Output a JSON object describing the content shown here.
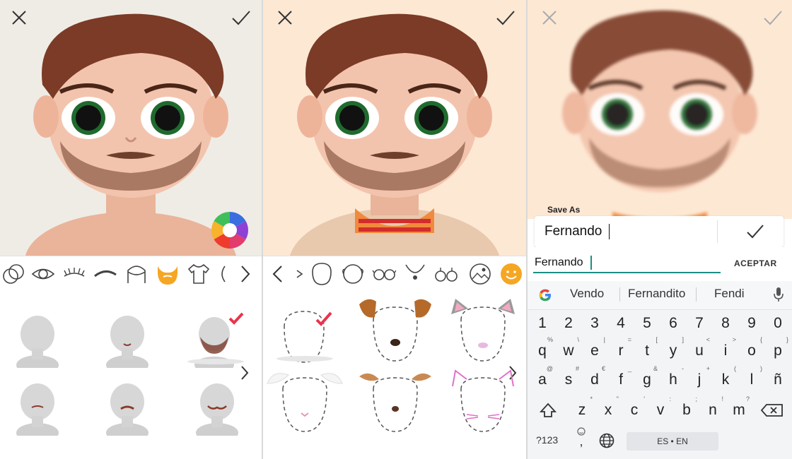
{
  "panels": {
    "dialog": {
      "label": "Save As",
      "value": "Fernando",
      "text_input": "Fernando",
      "accept_label": "ACEPTAR"
    },
    "keyboard": {
      "suggestions": [
        "Vendo",
        "Fernandito",
        "Fendi"
      ],
      "numbers": [
        "1",
        "2",
        "3",
        "4",
        "5",
        "6",
        "7",
        "8",
        "9",
        "0"
      ],
      "row1": [
        {
          "k": "q",
          "s": "%"
        },
        {
          "k": "w",
          "s": "\\"
        },
        {
          "k": "e",
          "s": "|"
        },
        {
          "k": "r",
          "s": "="
        },
        {
          "k": "t",
          "s": "["
        },
        {
          "k": "y",
          "s": "]"
        },
        {
          "k": "u",
          "s": "<"
        },
        {
          "k": "i",
          "s": ">"
        },
        {
          "k": "o",
          "s": "{"
        },
        {
          "k": "p",
          "s": "}"
        }
      ],
      "row2": [
        {
          "k": "a",
          "s": "@"
        },
        {
          "k": "s",
          "s": "#"
        },
        {
          "k": "d",
          "s": "€"
        },
        {
          "k": "f",
          "s": "_"
        },
        {
          "k": "g",
          "s": "&"
        },
        {
          "k": "h",
          "s": "-"
        },
        {
          "k": "j",
          "s": "+"
        },
        {
          "k": "k",
          "s": "("
        },
        {
          "k": "l",
          "s": ")"
        },
        {
          "k": "ñ",
          "s": ""
        }
      ],
      "row3": [
        {
          "k": "z",
          "s": "*"
        },
        {
          "k": "x",
          "s": "\""
        },
        {
          "k": "c",
          "s": "'"
        },
        {
          "k": "v",
          "s": ":"
        },
        {
          "k": "b",
          "s": ";"
        },
        {
          "k": "n",
          "s": "!"
        },
        {
          "k": "m",
          "s": "?"
        }
      ],
      "symbols_key": "?123",
      "comma_key": ",",
      "language_label": "ES • EN"
    }
  },
  "colors": {
    "accent_orange": "#f5a623",
    "check_red": "#e8344d",
    "text_cursor": "#1a8f85",
    "bg_panel1": "#efece6",
    "bg_panel2": "#fde8d4"
  },
  "icons": {
    "close": "close-icon",
    "confirm": "checkmark-icon",
    "color_wheel": "color-wheel-icon"
  }
}
